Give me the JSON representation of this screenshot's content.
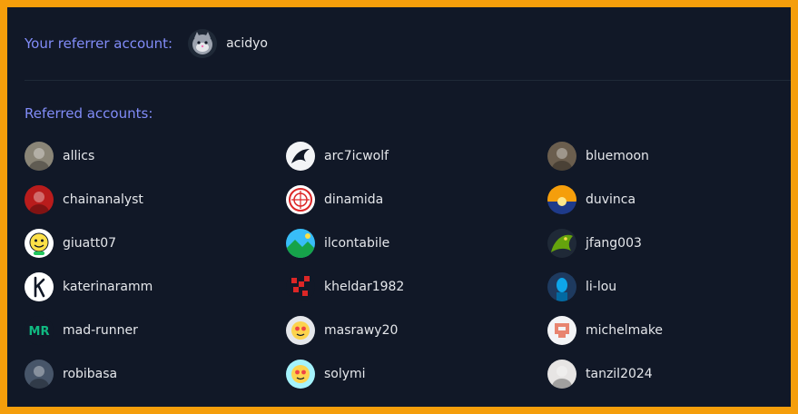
{
  "referrer": {
    "label": "Your referrer account:",
    "username": "acidyo",
    "avatar_icon": "cat-avatar-icon"
  },
  "referred": {
    "label": "Referred accounts:",
    "users": [
      {
        "username": "allics",
        "avatar_icon": "photo-avatar-icon",
        "bg": "#8a8577"
      },
      {
        "username": "arc7icwolf",
        "avatar_icon": "wolf-avatar-icon",
        "bg": "#f3f4f6"
      },
      {
        "username": "bluemoon",
        "avatar_icon": "photo-avatar-icon",
        "bg": "#6b5e4e"
      },
      {
        "username": "chainanalyst",
        "avatar_icon": "photo-avatar-icon",
        "bg": "#b91c1c"
      },
      {
        "username": "dinamida",
        "avatar_icon": "emblem-avatar-icon",
        "bg": "#ffffff"
      },
      {
        "username": "duvinca",
        "avatar_icon": "sunset-avatar-icon",
        "bg": "#f59e0b"
      },
      {
        "username": "giuatt07",
        "avatar_icon": "smiley-avatar-icon",
        "bg": "#fde047"
      },
      {
        "username": "ilcontabile",
        "avatar_icon": "landscape-avatar-icon",
        "bg": "#38bdf8"
      },
      {
        "username": "jfang003",
        "avatar_icon": "dragon-avatar-icon",
        "bg": "#65a30d"
      },
      {
        "username": "katerinaramm",
        "avatar_icon": "letter-k-avatar-icon",
        "bg": "#ffffff"
      },
      {
        "username": "kheldar1982",
        "avatar_icon": "pattern-avatar-icon",
        "bg": "#dc2626"
      },
      {
        "username": "li-lou",
        "avatar_icon": "portrait-avatar-icon",
        "bg": "#1e3a5f"
      },
      {
        "username": "mad-runner",
        "avatar_icon": "graffiti-avatar-icon",
        "bg": "#10b981"
      },
      {
        "username": "masrawy20",
        "avatar_icon": "cartoon-avatar-icon",
        "bg": "#e5e7eb"
      },
      {
        "username": "michelmake",
        "avatar_icon": "pixel-avatar-icon",
        "bg": "#f3f4f6"
      },
      {
        "username": "robibasa",
        "avatar_icon": "photo-avatar-icon",
        "bg": "#475569"
      },
      {
        "username": "solymi",
        "avatar_icon": "cartoon-avatar-icon",
        "bg": "#a5f3fc"
      },
      {
        "username": "tanzil2024",
        "avatar_icon": "photo-avatar-icon",
        "bg": "#e7e5e4"
      }
    ]
  },
  "colors": {
    "accent": "#818cf8",
    "background": "#111827",
    "frame": "#f59e0b",
    "text": "#e5e7eb"
  }
}
